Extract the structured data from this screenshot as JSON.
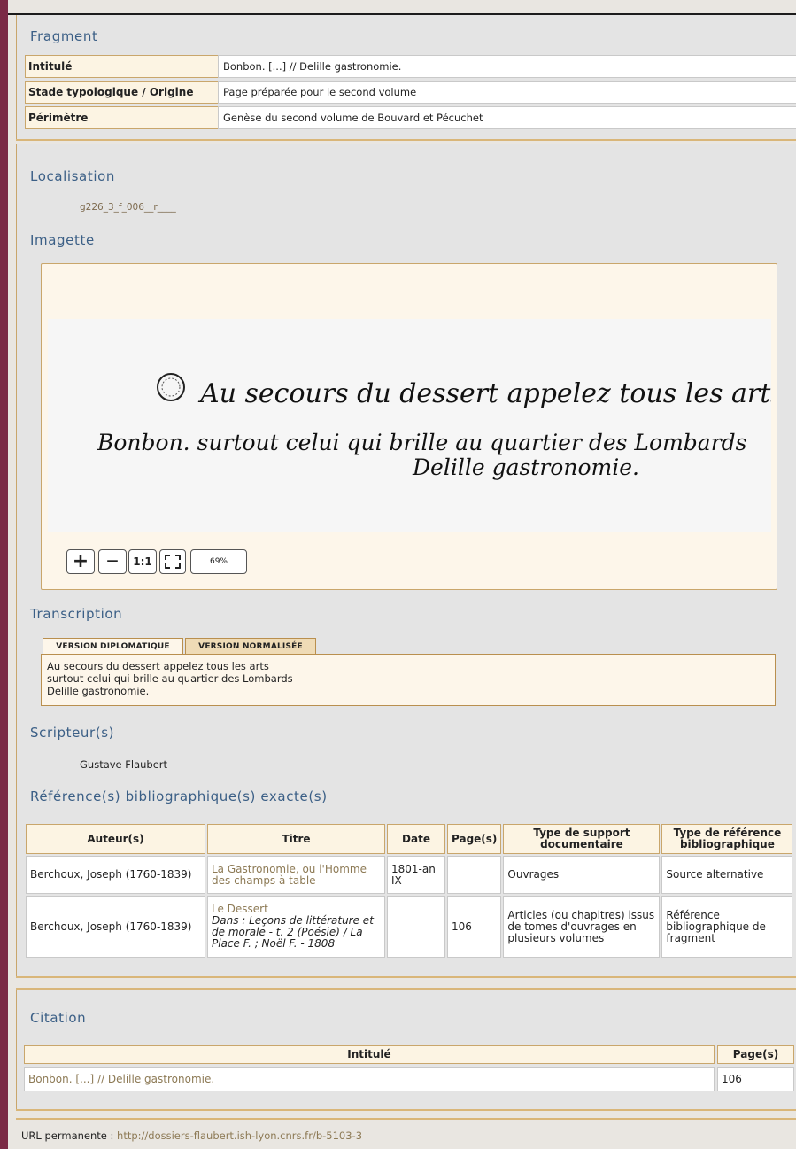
{
  "fragment": {
    "heading": "Fragment",
    "rows": [
      {
        "label": "Intitulé",
        "value": "Bonbon. [...] // Delille gastronomie."
      },
      {
        "label": "Stade typologique / Origine",
        "value": "Page préparée pour le second volume"
      },
      {
        "label": "Périmètre",
        "value": "Genèse du second volume de Bouvard et Pécuchet"
      }
    ]
  },
  "localisation": {
    "heading": "Localisation",
    "value": "g226_3_f_006__r____"
  },
  "imagette": {
    "heading": "Imagette",
    "manuscript_lines": [
      "Au secours du dessert appelez tous les arts",
      "Bonbon.   surtout celui qui brille au quartier des Lombards",
      "Delille gastronomie."
    ],
    "toolbar": {
      "zoom_in": "+",
      "zoom_out": "—",
      "actual_size": "1:1",
      "fit_icon": "fit-screen-icon",
      "zoom_level": "69%"
    }
  },
  "transcription": {
    "heading": "Transcription",
    "tabs": [
      "VERSION DIPLOMATIQUE",
      "VERSION NORMALISÉE"
    ],
    "lines": [
      "Au secours du dessert appelez tous les arts",
      "surtout celui qui brille au quartier des Lombards",
      "Delille gastronomie."
    ]
  },
  "scripteurs": {
    "heading": "Scripteur(s)",
    "value": "Gustave Flaubert"
  },
  "references": {
    "heading": "Référence(s) bibliographique(s) exacte(s)",
    "columns": [
      "Auteur(s)",
      "Titre",
      "Date",
      "Page(s)",
      "Type de support documentaire",
      "Type de référence bibliographique"
    ],
    "rows": [
      {
        "auteur": "Berchoux, Joseph (1760-1839)",
        "titre": "La Gastronomie, ou l'Homme des champs à table",
        "titre_extra": "",
        "date": "1801-an IX",
        "pages": "",
        "support": "Ouvrages",
        "type": "Source alternative"
      },
      {
        "auteur": "Berchoux, Joseph (1760-1839)",
        "titre": "Le Dessert",
        "titre_extra": "Dans : Leçons de littérature et de morale - t. 2 (Poésie) / La Place F. ; Noël F. - 1808",
        "date": "",
        "pages": "106",
        "support": "Articles (ou chapitres) issus de tomes d'ouvrages en plusieurs volumes",
        "type": "Référence bibliographique de fragment"
      }
    ]
  },
  "citation": {
    "heading": "Citation",
    "columns": [
      "Intitulé",
      "Page(s)"
    ],
    "intitule": "Bonbon. [...] // Delille gastronomie.",
    "pages": "106"
  },
  "footer": {
    "label": "URL permanente : ",
    "url": "http://dossiers-flaubert.ish-lyon.cnrs.fr/b-5103-3"
  },
  "colors": {
    "accent": "#3b5f86",
    "border": "#c9a66b",
    "sidebar": "#7b2a45",
    "panel": "#fcf4e3"
  }
}
